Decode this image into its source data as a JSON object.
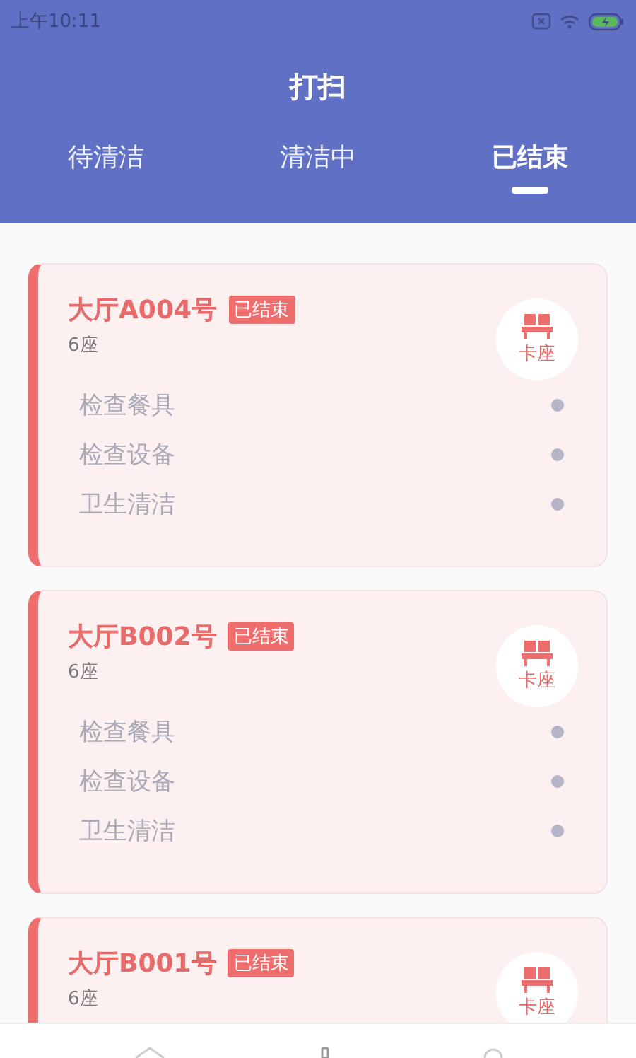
{
  "status_bar": {
    "time": "上午10:11"
  },
  "header": {
    "title": "打扫"
  },
  "tabs": [
    {
      "label": "待清洁",
      "selected": false
    },
    {
      "label": "清洁中",
      "selected": false
    },
    {
      "label": "已结束",
      "selected": true
    }
  ],
  "cards": [
    {
      "name": "大厅A004号",
      "status": "已结束",
      "seats": "6座",
      "seat_type": "卡座",
      "checks": [
        "检查餐具",
        "检查设备",
        "卫生清洁"
      ]
    },
    {
      "name": "大厅B002号",
      "status": "已结束",
      "seats": "6座",
      "seat_type": "卡座",
      "checks": [
        "检查餐具",
        "检查设备",
        "卫生清洁"
      ]
    },
    {
      "name": "大厅B001号",
      "status": "已结束",
      "seats": "6座",
      "seat_type": "卡座"
    }
  ]
}
